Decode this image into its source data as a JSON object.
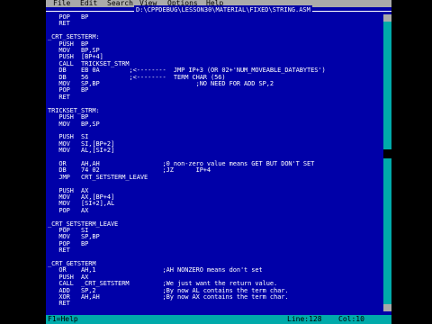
{
  "window": {
    "title": "D:\\CPPDEBUG\\LESSON30\\MATERIAL\\FIXED\\STRING.ASM"
  },
  "menubar": {
    "items": [
      "File",
      "Edit",
      "Search",
      "View",
      "Options",
      "Help"
    ]
  },
  "editor": {
    "code_lines": [
      "   POP   BP",
      "   RET",
      "",
      "_CRT_SETSTERM:",
      "   PUSH  BP",
      "   MOV   BP,SP",
      "   PUSH  [BP+4]",
      "   CALL  TRICKSET_STRM",
      "   DB    EB 0A        ;<--------  JMP IP+3 (OR 02+'NUM_MOVEABLE_DATABYTES')",
      "   DB    56           ;<--------  TERM CHAR (56)",
      "   MOV   SP,BP                          ;NO NEED FOR ADD SP,2",
      "   POP   BP",
      "   RET",
      "",
      "TRICKSET_STRM:",
      "   PUSH  BP",
      "   MOV   BP,SP",
      "",
      "   PUSH  SI",
      "   MOV   SI,[BP+2]",
      "   MOV   AL,[SI+2]",
      "",
      "   OR    AH,AH                 ;0 non-zero value means GET BUT DON'T SET",
      "   DB    74 02                 ;JZ      IP+4",
      "   JMP   CRT_SETSTERM_LEAVE",
      "",
      "   PUSH  AX",
      "   MOV   AX,[BP+4]",
      "   MOV   [SI+2],AL",
      "   POP   AX",
      "",
      "_CRT_SETSTERM_LEAVE",
      "   POP   SI",
      "   MOV   SP,BP",
      "   POP   BP",
      "   RET",
      "",
      "_CRT_GETSTERM",
      "   OR    AH,1                  ;AH NONZERO means don't set",
      "   PUSH  AX",
      "   CALL  _CRT_SETSTERM         ;We just want the return value.",
      "   ADD   SP,2                  ;By now AL contains the term char.",
      "   XOR   AH,AH                 ;By now AX contains the term char.",
      "   RET"
    ]
  },
  "statusbar": {
    "help": "F1=Help",
    "line": "Line:128",
    "col": "Col:10"
  }
}
